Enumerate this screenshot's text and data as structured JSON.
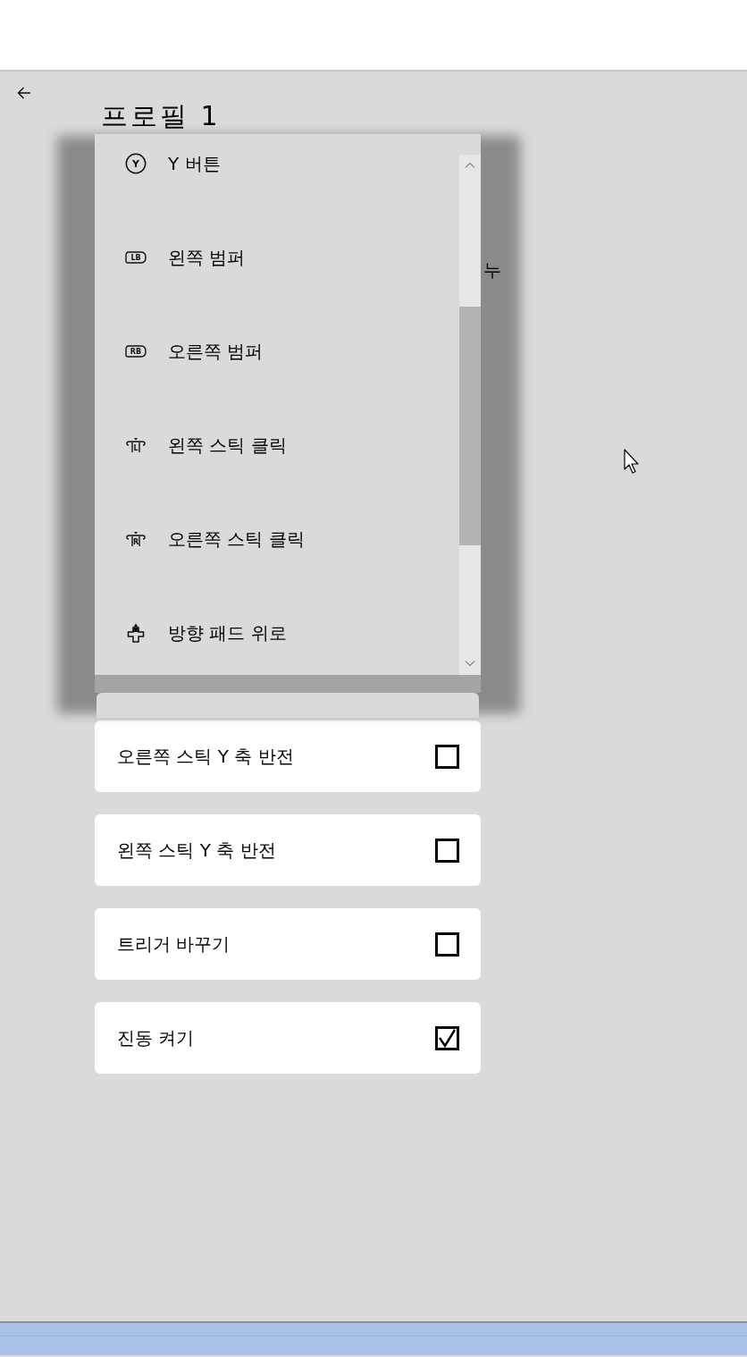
{
  "page": {
    "title": "프로필 1",
    "side_label": "누"
  },
  "dropdown": {
    "items": [
      {
        "label": "Y 버튼",
        "kind": "face",
        "icon_text": "Y",
        "selected": false
      },
      {
        "label": "왼쪽 범퍼",
        "kind": "bumper",
        "icon_text": "LB",
        "selected": false
      },
      {
        "label": "오른쪽 범퍼",
        "kind": "bumper",
        "icon_text": "RB",
        "selected": false
      },
      {
        "label": "왼쪽 스틱 클릭",
        "kind": "stick",
        "icon_text": "L",
        "selected": false
      },
      {
        "label": "오른쪽 스틱 클릭",
        "kind": "stick",
        "icon_text": "R",
        "selected": false
      },
      {
        "label": "방향 패드 위로",
        "kind": "dpad",
        "selected": false
      }
    ]
  },
  "settings": [
    {
      "label": "오른쪽 스틱 Y 축 반전",
      "checked": false
    },
    {
      "label": "왼쪽 스틱 Y 축 반전",
      "checked": false
    },
    {
      "label": "트리거 바꾸기",
      "checked": false
    },
    {
      "label": "진동 켜기",
      "checked": true
    }
  ]
}
